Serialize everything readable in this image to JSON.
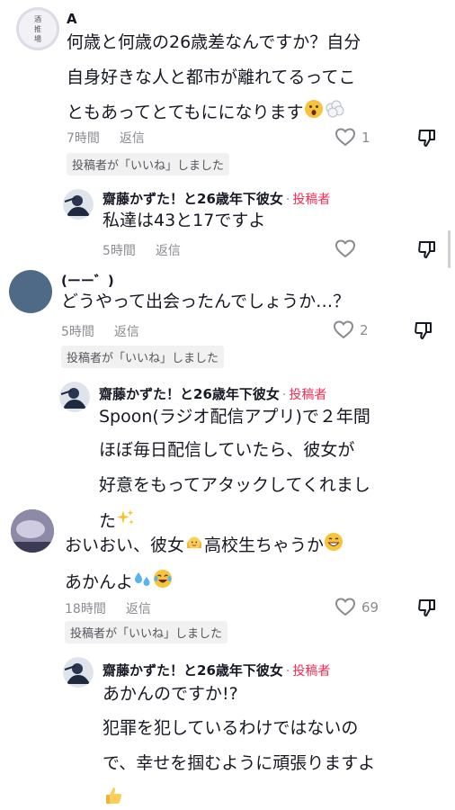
{
  "comments": [
    {
      "author": "A",
      "avatar_text": "酒\n推\n場",
      "lines": [
        "何歳と何歳の26歳差なんですか？自分",
        "自身好きな人と都市が離れてるってこ",
        "ともあってとてもにになります"
      ],
      "time": "7時間",
      "reply": "返信",
      "likes": "1",
      "liked_badge": "投稿者が「いいね」しました",
      "reply_item": {
        "author": "齋藤かずた！と26歳年下彼女",
        "tag": "投稿者",
        "lines": [
          "私達は43と17ですよ"
        ],
        "time": "5時間",
        "reply": "返信"
      }
    },
    {
      "author": "(ーー゛)",
      "lines": [
        "どうやって出会ったんでしょうか…？"
      ],
      "time": "5時間",
      "reply": "返信",
      "likes": "2",
      "liked_badge": "投稿者が「いいね」しました",
      "reply_item": {
        "author": "齋藤かずた！と26歳年下彼女",
        "tag": "投稿者",
        "lines": [
          "Spoon(ラジオ配信アプリ)で２年間",
          "ほぼ毎日配信していたら、彼女が",
          "好意をもってアタックしてくれまし",
          "た"
        ]
      }
    },
    {
      "lines": [
        "おいおい、彼女",
        "高校生ちゃうか",
        "あかんよ"
      ],
      "time": "18時間",
      "reply": "返信",
      "likes": "69",
      "liked_badge": "投稿者が「いいね」しました",
      "reply_item": {
        "author": "齋藤かずた！と26歳年下彼女",
        "tag": "投稿者",
        "lines": [
          "あかんのですか!?",
          "犯罪を犯しているわけではないの",
          "で、幸せを掴むように頑張りますよ"
        ]
      }
    }
  ],
  "icons": {
    "heart": "heart-outline-icon",
    "dislike": "thumbs-down-icon",
    "sparkles": "sparkles-icon",
    "surprised": "surprised-face-emoji",
    "thought": "thought-balloon-emoji",
    "girl": "girl-emoji",
    "grin": "grinning-face-emoji",
    "sweat": "sweat-droplets-emoji",
    "laugh": "tears-of-joy-emoji",
    "thumbs_up": "thumbs-up-emoji"
  },
  "colors": {
    "author_tag": "#fe2c55",
    "meta": "#8a8b91",
    "badge_bg": "#f1f1f2"
  }
}
